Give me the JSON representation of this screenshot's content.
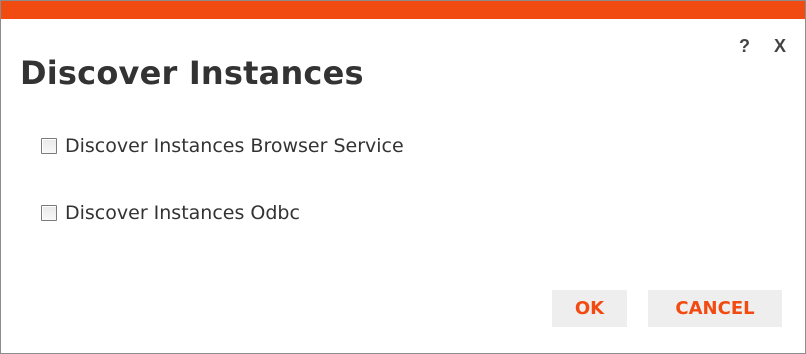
{
  "dialog": {
    "title": "Discover Instances",
    "help_label": "?",
    "close_label": "X",
    "options": [
      {
        "label": "Discover Instances Browser Service",
        "checked": false
      },
      {
        "label": "Discover Instances Odbc",
        "checked": false
      }
    ],
    "ok_label": "OK",
    "cancel_label": "CANCEL"
  },
  "colors": {
    "accent": "#f24b12",
    "button_bg": "#eeeeee",
    "text": "#333333"
  }
}
